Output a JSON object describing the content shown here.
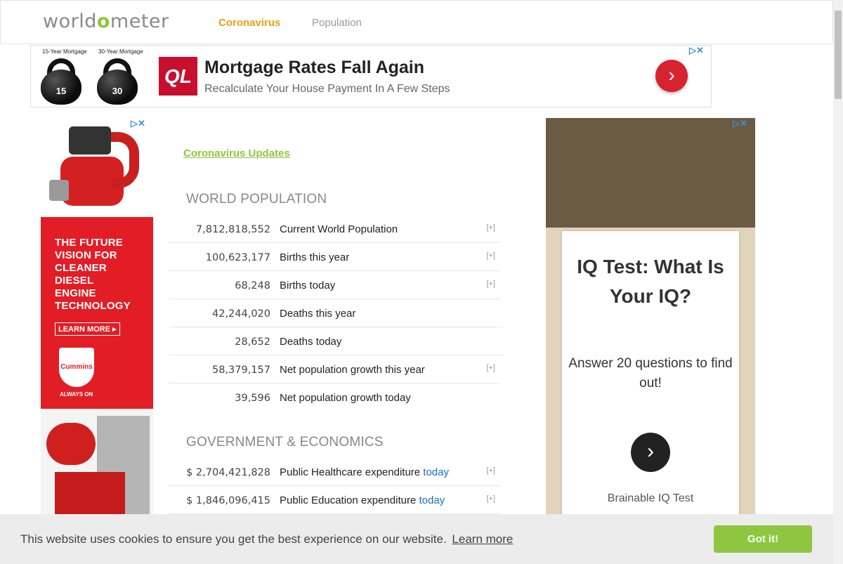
{
  "header": {
    "logo_prefix": "world",
    "logo_o": "o",
    "logo_suffix": "meter",
    "nav": [
      {
        "label": "Coronavirus"
      },
      {
        "label": "Population"
      }
    ]
  },
  "top_ad": {
    "caption_left": "15-Year Mortgage",
    "caption_right": "30-Year Mortgage",
    "kettlebell_left": "15",
    "kettlebell_right": "30",
    "brand": "QL",
    "headline": "Mortgage Rates Fall Again",
    "subline": "Recalculate Your House Payment In A Few Steps",
    "arrow_icon": "chevron-right-icon"
  },
  "left_ad": {
    "lines": [
      "THE FUTURE",
      "VISION FOR",
      "CLEANER",
      "DIESEL",
      "ENGINE",
      "TECHNOLOGY"
    ],
    "cta": "LEARN MORE ▸",
    "brand": "Cummins",
    "tagline": "ALWAYS ON",
    "accent_color": "#e21d25"
  },
  "main": {
    "updates_link": "Coronavirus Updates",
    "world_population": {
      "title": "WORLD POPULATION",
      "rows": [
        {
          "value": "7,812,818,552",
          "label": "Current World Population",
          "expand": "[+]"
        },
        {
          "value": "100,623,177",
          "label": "Births this year",
          "expand": "[+]"
        },
        {
          "value": "68,248",
          "label": "Births today",
          "expand": "[+]"
        },
        {
          "value": "42,244,020",
          "label": "Deaths this year",
          "expand": ""
        },
        {
          "value": "28,652",
          "label": "Deaths today",
          "expand": ""
        },
        {
          "value": "58,379,157",
          "label": "Net population growth this year",
          "expand": "[+]"
        },
        {
          "value": "39,596",
          "label": "Net population growth today",
          "expand": ""
        }
      ]
    },
    "government_economics": {
      "title": "GOVERNMENT & ECONOMICS",
      "rows": [
        {
          "value": "$ 2,704,421,828",
          "label": "Public Healthcare expenditure",
          "today": "today",
          "expand": "[+]"
        },
        {
          "value": "$ 1,846,096,415",
          "label": "Public Education expenditure",
          "today": "today",
          "expand": "[+]"
        }
      ]
    }
  },
  "right_ad": {
    "title": "IQ Test: What Is Your IQ?",
    "subtitle": "Answer 20 questions to find out!",
    "brand": "Brainable IQ Test",
    "arrow_icon": "chevron-right-icon"
  },
  "cookie": {
    "message": "This website uses cookies to ensure you get the best experience on our website.",
    "learn_more": "Learn more",
    "accept": "Got it!",
    "accept_color": "#8ec63f"
  },
  "colors": {
    "brand_green": "#8ec63f",
    "nav_active": "#e8a013",
    "link_blue": "#1a6fc9"
  }
}
